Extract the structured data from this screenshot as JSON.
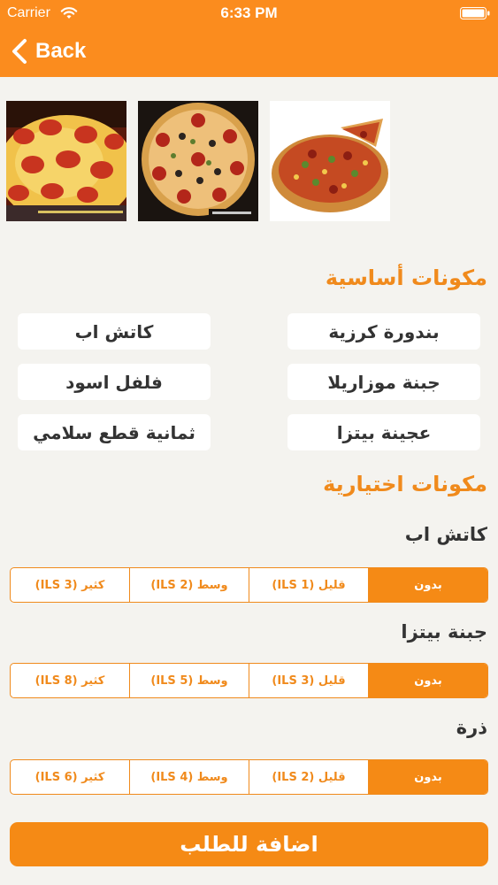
{
  "status_bar": {
    "carrier": "Carrier",
    "time": "6:33 PM"
  },
  "nav": {
    "back_label": "Back"
  },
  "gallery": {
    "images": [
      "pizza-pepperoni-slice",
      "pizza-pepperoni-olive",
      "pizza-supreme-slice"
    ]
  },
  "basic_ingredients": {
    "title": "مكونات أساسية",
    "items": [
      "بندورة كرزية",
      "كاتش اب",
      "جبنة موزاريلا",
      "فلفل اسود",
      "عجينة بيتزا",
      "ثمانية قطع سلامي"
    ]
  },
  "optional_ingredients": {
    "title": "مكونات اختيارية",
    "groups": [
      {
        "label": "كاتش اب",
        "options": [
          "بدون",
          "قليل (ILS 1)",
          "وسط (ILS 2)",
          "كثير (ILS 3)"
        ],
        "selected_index": 0
      },
      {
        "label": "جبنة بيتزا",
        "options": [
          "بدون",
          "قليل (ILS 3)",
          "وسط (ILS 5)",
          "كثير (ILS 8)"
        ],
        "selected_index": 0
      },
      {
        "label": "ذرة",
        "options": [
          "بدون",
          "قليل (ILS 2)",
          "وسط (ILS 4)",
          "كثير (ILS 6)"
        ],
        "selected_index": 0
      }
    ]
  },
  "add_button_label": "اضافة للطلب",
  "colors": {
    "accent": "#fb8c1e",
    "background": "#f4f3ef",
    "chip": "#ffffff"
  }
}
